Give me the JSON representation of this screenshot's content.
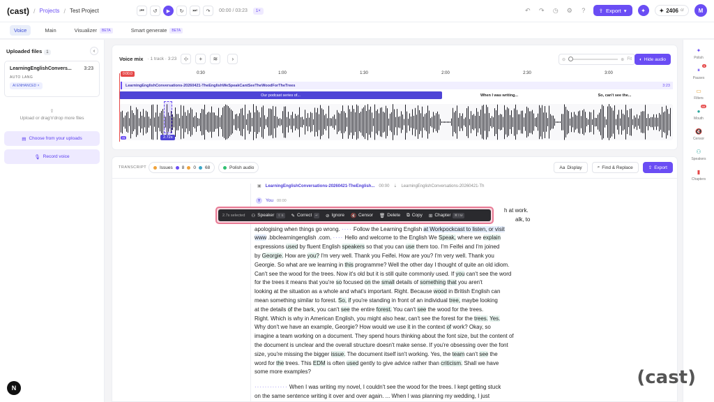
{
  "header": {
    "logo": "(cast)",
    "crumb_sep": "/",
    "projects": "Projects",
    "project_name": "Test Project",
    "timecode": "00:00 / 03:23",
    "speed": "1×",
    "export_label": "Export",
    "credits": "2406",
    "credits_unit": "cr",
    "avatar_initial": "M"
  },
  "tabs": [
    {
      "label": "Voice",
      "active": true
    },
    {
      "label": "Main"
    },
    {
      "label": "Visualizer",
      "beta": "BETA"
    },
    {
      "label": "Smart generate",
      "beta": "BETA"
    }
  ],
  "left": {
    "title": "Uploaded files",
    "count": "1",
    "file": {
      "name": "LearningEnglishConvers...",
      "duration": "3:23",
      "lang": "AUTO LANG",
      "tag": "AI ENHANCED"
    },
    "upload_text": "Upload or drag'n'drop more files",
    "choose_btn": "Choose from your uploads",
    "record_btn": "Record voice",
    "badge": "N"
  },
  "voice": {
    "title": "Voice mix",
    "sub": "· 1 track · 3:23",
    "zoom_fit": "Fit",
    "hide_audio": "Hide audio",
    "playhead_time": "0:00.0",
    "ticks": [
      "0:30",
      "1:00",
      "1:30",
      "2:00",
      "2:30",
      "3:00"
    ],
    "track_name": "LearningEnglishConversations-20260421-TheEnglishWeSpeakCantSeeTheWoodForTheTrees",
    "track_dur": "3:23",
    "segments": [
      "Our podcast series of...",
      "When I was writing...",
      "So, can't see the..."
    ],
    "selection": "2.72s",
    "ai_tag": "AI"
  },
  "transcript": {
    "label": "TRANSCRIPT",
    "issues_label": "Issues",
    "issues": [
      "8",
      "0",
      "68"
    ],
    "polish": "Polish audio",
    "display": "Display",
    "find": "Find & Replace",
    "export": "Export",
    "file_name": "LearningEnglishConversations-20260421-TheEnglish...",
    "file_time": "00:00",
    "file_ref": "LearningEnglishConversations-20260421-Th",
    "speaker": "You",
    "speaker_time": "00:00",
    "speaker_initial": "Y",
    "para1_a": "Our podcast series of ... h at work.",
    "para1_b": "... alk, to",
    "para2_start": "When I was writing my novel, I couldn't see the wood for the trees. I kept getting stuck",
    "para2_end": "on the same sentence writing it over and over again. ... When I was planning my wedding, I just"
  },
  "toolbar": {
    "selected": "2.7s selected",
    "speaker": "Speaker",
    "speaker_key": "⇧ S",
    "correct": "Correct",
    "correct_key": "↵",
    "ignore": "Ignore",
    "censor": "Censor",
    "delete": "Delete",
    "copy": "Copy",
    "chapter": "Chapter",
    "chapter_key": "⌘⇧M"
  },
  "rail": [
    {
      "label": "Polish",
      "icon": "sparkle-icon"
    },
    {
      "label": "Pauses",
      "icon": "pause-icon",
      "badge": "9"
    },
    {
      "label": "Filters",
      "icon": "filter-icon"
    },
    {
      "label": "Mouth",
      "icon": "mouth-icon",
      "badge": "68"
    },
    {
      "label": "Censor",
      "icon": "mute-icon"
    },
    {
      "label": "Speakers",
      "icon": "speakers-icon"
    },
    {
      "label": "Chapters",
      "icon": "bookmark-icon"
    }
  ],
  "watermark": "(cast)"
}
